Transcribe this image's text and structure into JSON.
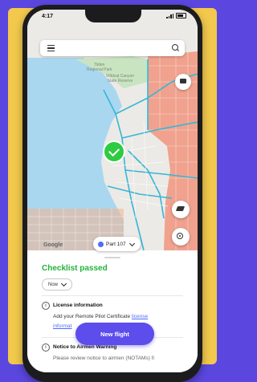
{
  "status_bar": {
    "time": "4:17"
  },
  "map": {
    "labels": [
      "Tilden",
      "Regional Park",
      "Wildcat Canyon",
      "State Reserve"
    ],
    "attribution": "Google",
    "restricted_color": "#f17a5f",
    "grid_color": "#f3a37a",
    "road_color": "#35b6d6"
  },
  "part_selector": {
    "label": "Part 107"
  },
  "checklist": {
    "title": "Checklist passed",
    "time_option": "Now",
    "items": [
      {
        "title": "License information",
        "text_prefix": "Add your Remote Pilot Certificate",
        "link_line1": "license",
        "link_line2": "informat"
      },
      {
        "title": "Notice to Airmen Warning",
        "text": "Please review notice to airmen (NOTAMs) fi"
      }
    ]
  },
  "primary_action": {
    "label": "New flight",
    "color": "#5c4dec"
  },
  "accent_status_color": "#22b33a"
}
